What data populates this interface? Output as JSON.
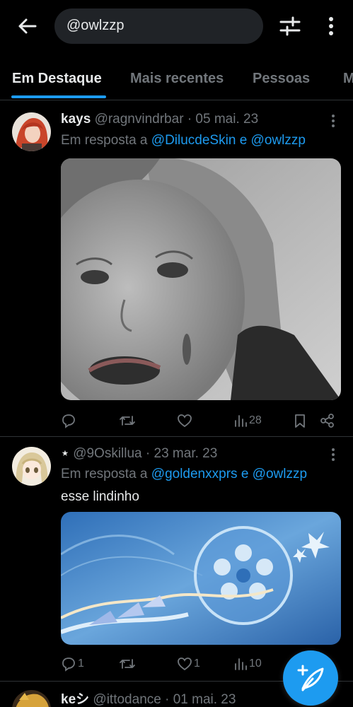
{
  "search": {
    "query": "@owlzzp"
  },
  "tabs": [
    {
      "label": "Em Destaque",
      "active": true
    },
    {
      "label": "Mais recentes",
      "active": false
    },
    {
      "label": "Pessoas",
      "active": false
    },
    {
      "label": "M",
      "active": false
    }
  ],
  "tweets": [
    {
      "name": "kays",
      "handle": "@ragnvindrbar",
      "date": "· 05 mai. 23",
      "reply_prefix": "Em resposta a",
      "reply_user1": "@DilucdeSkin",
      "reply_and": "e",
      "reply_user2": "@owlzzp",
      "text": "",
      "actions": {
        "replies": "",
        "retweets": "",
        "likes": "",
        "views": "28"
      },
      "media": "grayscale-photo"
    },
    {
      "name": "⋆",
      "handle": "@9Oskillua",
      "date": "· 23 mar. 23",
      "reply_prefix": "Em resposta a",
      "reply_user1": "@goldenxxprs",
      "reply_and": "e",
      "reply_user2": "@owlzzp",
      "text": "esse lindinho",
      "actions": {
        "replies": "1",
        "retweets": "",
        "likes": "1",
        "views": "10"
      },
      "media": "blue-illustration"
    },
    {
      "name": "keシ",
      "handle": "@ittodance",
      "date": "· 01 mai. 23"
    }
  ],
  "icons": {
    "back": "arrow-left-icon",
    "filter": "sliders-icon",
    "more": "vertical-dots-icon",
    "reply": "comment-icon",
    "retweet": "retweet-icon",
    "like": "heart-icon",
    "views": "bar-chart-icon",
    "bookmark": "bookmark-icon",
    "share": "share-icon",
    "compose": "feather-plus-icon"
  },
  "colors": {
    "accent": "#1d9bf0",
    "background": "#000000",
    "muted": "#71767b",
    "text": "#e7e9ea"
  }
}
